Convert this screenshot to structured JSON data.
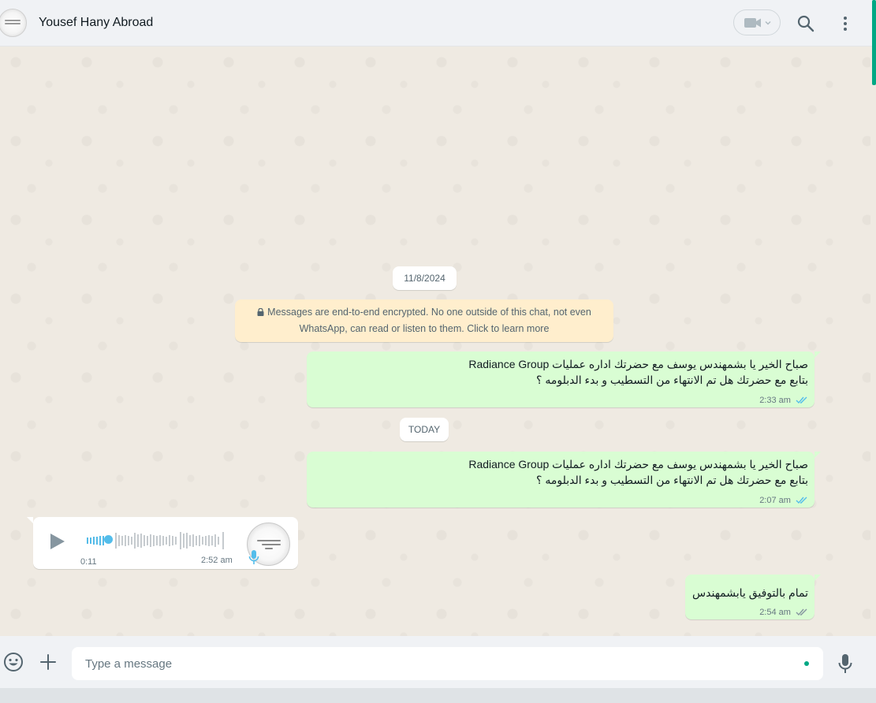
{
  "header": {
    "contact_name": "Yousef Hany Abroad"
  },
  "chat": {
    "dates": {
      "first": "11/8/2024",
      "second": "TODAY"
    },
    "encryption_notice": {
      "line1": "Messages are end-to-end encrypted. No one outside of this chat, not even",
      "line2": "WhatsApp, can read or listen to them. Click to learn more"
    },
    "messages": [
      {
        "line1": "صباح الخير يا بشمهندس يوسف مع  حضرتك اداره عمليات Radiance Group",
        "line2": "بتابع مع حضرتك هل تم الانتهاء من التسطيب و بدء الدبلومه ؟",
        "time": "2:33 am"
      },
      {
        "line1": "صباح الخير يا بشمهندس يوسف مع  حضرتك اداره عمليات Radiance Group",
        "line2": "بتابع مع حضرتك هل تم الانتهاء من التسطيب و بدء الدبلومه ؟",
        "time": "2:07 am"
      },
      {
        "line1": "تمام بالتوفيق يابشمهندس",
        "time": "2:54 am"
      }
    ],
    "voice_note": {
      "duration": "0:11",
      "time": "2:52 am",
      "progress": 0.15
    }
  },
  "composer": {
    "placeholder": "Type a message"
  },
  "colors": {
    "outgoing_bubble": "#d9fdd3",
    "accent": "#00a884",
    "read_ticks": "#53bdeb"
  }
}
